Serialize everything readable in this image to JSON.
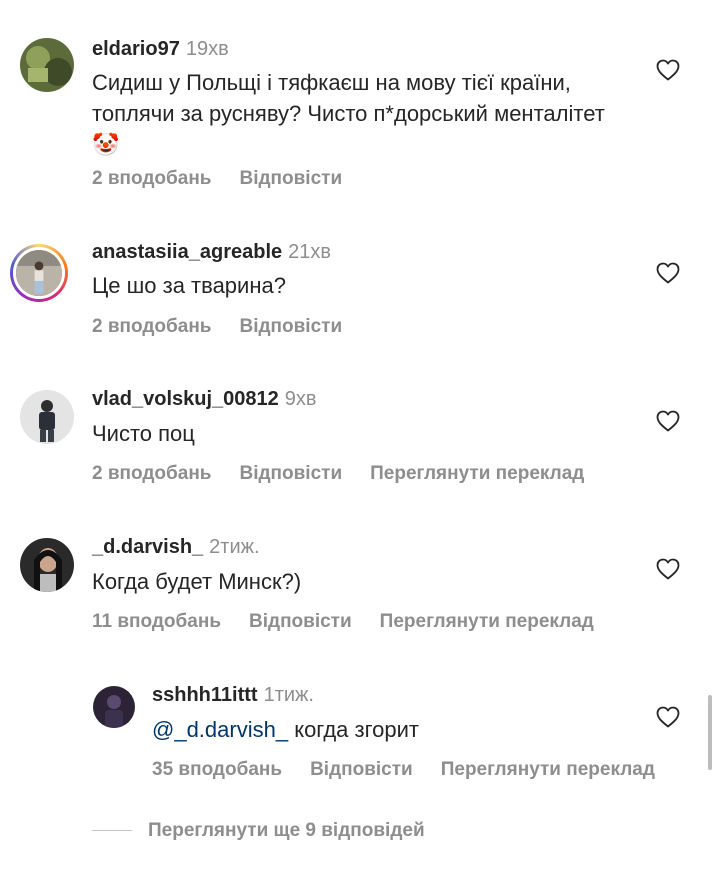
{
  "comments": [
    {
      "username": "eldario97",
      "time": "19хв",
      "text": "Сидиш у Польщі і тяфкаєш на мову тієї країни, топлячи за русняву? Чисто п*дорський менталітет",
      "emoji": "🤡",
      "likes": "2 вподобань",
      "reply": "Відповісти"
    },
    {
      "username": "anastasiia_agreable",
      "time": "21хв",
      "text": "Це шо за тварина?",
      "likes": "2 вподобань",
      "reply": "Відповісти"
    },
    {
      "username": "vlad_volskuj_00812",
      "time": "9хв",
      "text": "Чисто поц",
      "likes": "2 вподобань",
      "reply": "Відповісти",
      "translate": "Переглянути переклад"
    },
    {
      "username": "_d.darvish_",
      "time": "2тиж.",
      "text": "Когда будет Минск?)",
      "likes": "11 вподобань",
      "reply": "Відповісти",
      "translate": "Переглянути переклад"
    },
    {
      "username": "sshhh11ittt",
      "time": "1тиж.",
      "mention": "@_d.darvish_",
      "text": " когда згорит",
      "likes": "35 вподобань",
      "reply": "Відповісти",
      "translate": "Переглянути переклад"
    }
  ],
  "view_more": "Переглянути ще 9 відповідей",
  "icons": {
    "like": "heart-outline-icon"
  },
  "colors": {
    "text": "#262626",
    "secondary": "#8e8e8e",
    "mention": "#00376b"
  }
}
